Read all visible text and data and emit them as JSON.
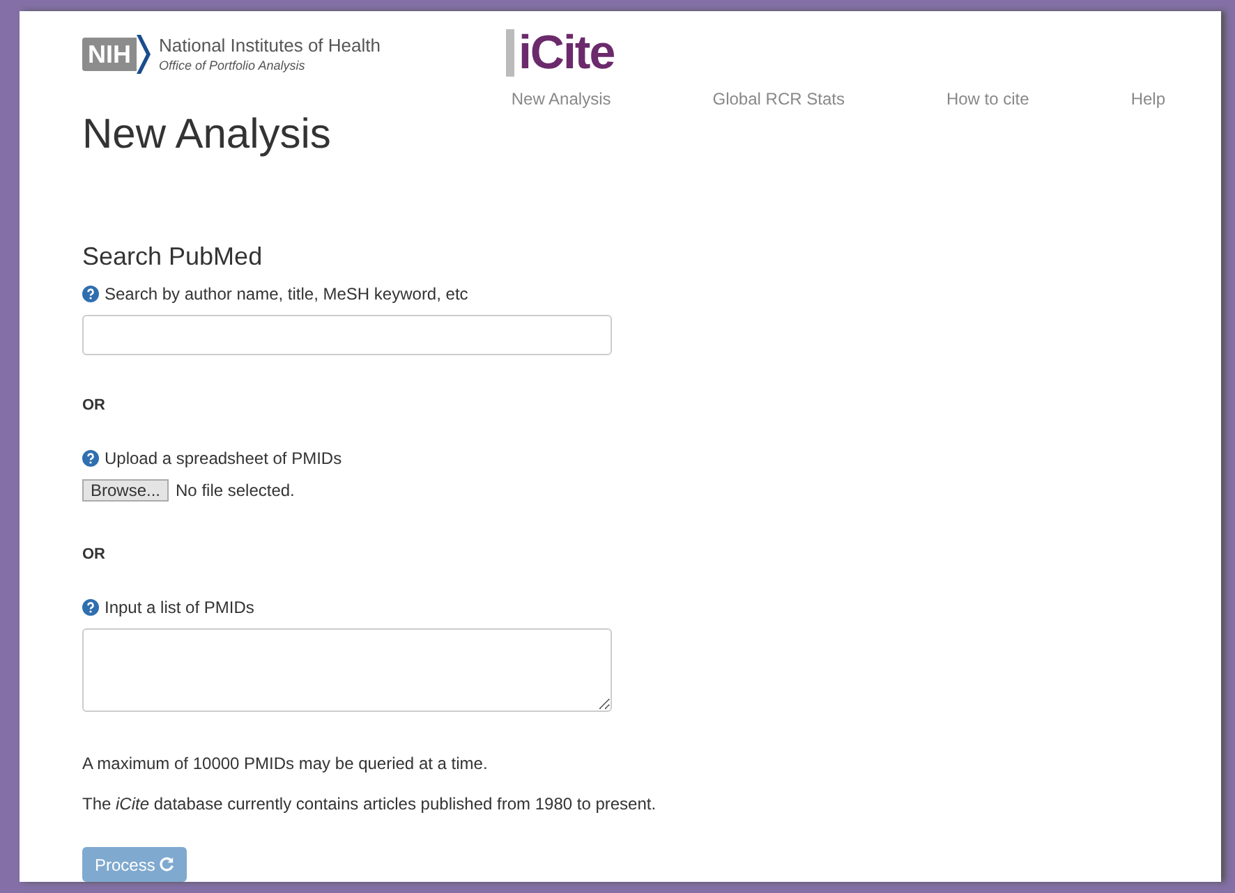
{
  "header": {
    "org_logo": {
      "badge": "NIH",
      "name": "National Institutes of Health",
      "office": "Office of Portfolio Analysis"
    },
    "app_logo": "iCite"
  },
  "nav": [
    {
      "label": "New Analysis"
    },
    {
      "label": "Global RCR Stats"
    },
    {
      "label": "How to cite"
    },
    {
      "label": "Help"
    }
  ],
  "page_title": "New Analysis",
  "section_title": "Search PubMed",
  "search": {
    "label": "Search by author name, title, MeSH keyword, etc"
  },
  "separator_1": "OR",
  "upload": {
    "label": "Upload a spreadsheet of PMIDs",
    "button": "Browse...",
    "status": "No file selected."
  },
  "separator_2": "OR",
  "pmid_list": {
    "label": "Input a list of PMIDs"
  },
  "notes": [
    "A maximum of 10000 PMIDs may be queried at a time.",
    "The *iCite* database currently contains articles published from 1980 to present."
  ],
  "process_button": {
    "label": "Process",
    "disabled": true
  }
}
